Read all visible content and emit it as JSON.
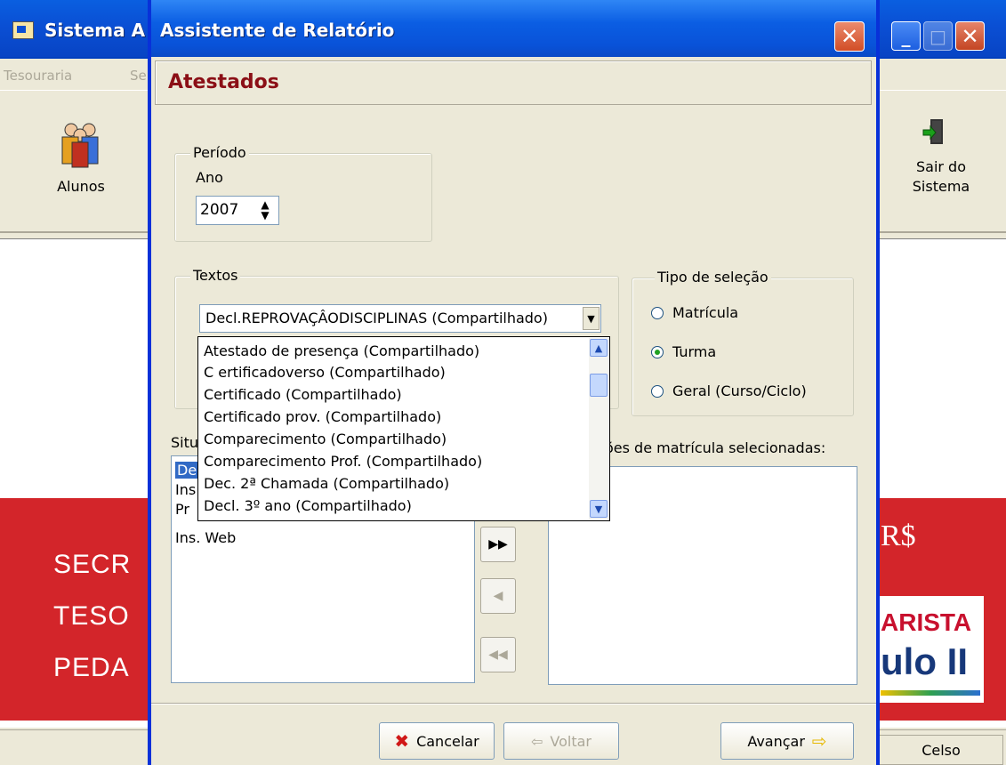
{
  "main_window": {
    "title": "Sistema A",
    "menu": [
      "Tesouraria",
      "Se"
    ],
    "toolbar": {
      "alunos_label": "Alunos",
      "sair_line1": "Sair do",
      "sair_line2": "Sistema"
    },
    "banner_left": [
      "SECR",
      "TESO",
      "PEDA"
    ],
    "banner_right": [
      "R$",
      "ARISTA",
      "ulo II"
    ],
    "status_user": "Celso"
  },
  "dialog": {
    "title": "Assistente de Relatório",
    "header": "Atestados",
    "periodo": {
      "legend": "Período",
      "ano_label": "Ano",
      "ano_value": "2007"
    },
    "textos": {
      "legend": "Textos",
      "selected": "Decl.REPROVAÇÂODISCIPLINAS   (Compartilhado)",
      "options": [
        "Atestado de presença   (Compartilhado)",
        "C ertificadoverso   (Compartilhado)",
        "Certificado   (Compartilhado)",
        "Certificado prov.   (Compartilhado)",
        "Comparecimento   (Compartilhado)",
        "Comparecimento Prof.   (Compartilhado)",
        "Dec. 2ª Chamada   (Compartilhado)",
        "Decl. 3º ano   (Compartilhado)"
      ]
    },
    "tipo_selecao": {
      "legend": "Tipo de seleção",
      "options": [
        {
          "label": "Matrícula",
          "selected": false
        },
        {
          "label": "Turma",
          "selected": true
        },
        {
          "label": "Geral (Curso/Ciclo)",
          "selected": false
        }
      ]
    },
    "situacoes": {
      "label_prefix": "Situ",
      "items": [
        "De",
        "Ins",
        "Pr",
        "Ins. Web"
      ]
    },
    "selecionadas": {
      "label": "ões de matrícula selecionadas:"
    },
    "buttons": {
      "cancelar": "Cancelar",
      "voltar": "Voltar",
      "avancar": "Avançar"
    }
  }
}
